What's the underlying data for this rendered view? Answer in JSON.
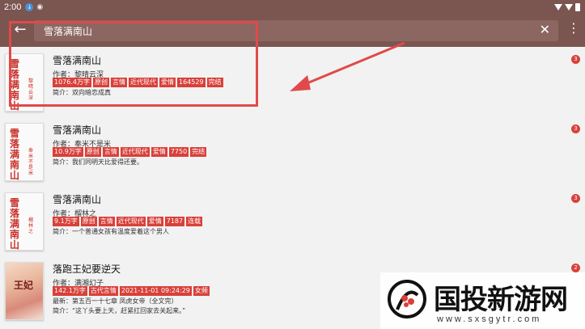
{
  "statusbar": {
    "time": "2:00",
    "notif_icon": "download-icon",
    "extra_icon": "shield-icon"
  },
  "appbar": {
    "query": "雪落满南山"
  },
  "books": [
    {
      "title": "雪落满南山",
      "author": "作者：黎晴云深",
      "tags": [
        "1076.4万字",
        "原创",
        "言情",
        "近代现代",
        "爱情",
        "164529",
        "完结"
      ],
      "intro": "简介：双向暗恋成真",
      "badge": "3",
      "cover_title": "雪落满南山",
      "cover_author": "黎晴云深"
    },
    {
      "title": "雪落满南山",
      "author": "作者：奉米不是米",
      "tags": [
        "10.9万字",
        "原创",
        "言情",
        "近代现代",
        "爱情",
        "7750",
        "完结"
      ],
      "intro": "简介：我们同明天比爱得还要。",
      "badge": "3",
      "cover_title": "雪落满南山",
      "cover_author": "奉米不是米"
    },
    {
      "title": "雪落满南山",
      "author": "作者：榴林之",
      "tags": [
        "9.1万字",
        "原创",
        "言情",
        "近代现代",
        "爱情",
        "7187",
        "连载"
      ],
      "intro": "简介：一个普通女孩有温度爱着这个男人",
      "badge": "3",
      "cover_title": "雪落满南山",
      "cover_author": "榴林之"
    },
    {
      "title": "落跑王妃要逆天",
      "author": "作者：满湘幻子",
      "tags": [
        "142.1万字",
        "古代言情",
        "2021-11-01 09:24:29",
        "女频"
      ],
      "latest": "最新：第五百一十七章 凤虎女帝（全文完）",
      "intro": "简介：“这丫头要上天，赶紧扛回家去关起来。”",
      "badge": "2",
      "cover_title": "王妃"
    }
  ],
  "watermark": {
    "text": "国投新游网",
    "url": "www.sxsgytr.com"
  },
  "colors": {
    "primary": "#7b5550",
    "accent": "#d9403a",
    "annotation": "#e04a4a"
  }
}
